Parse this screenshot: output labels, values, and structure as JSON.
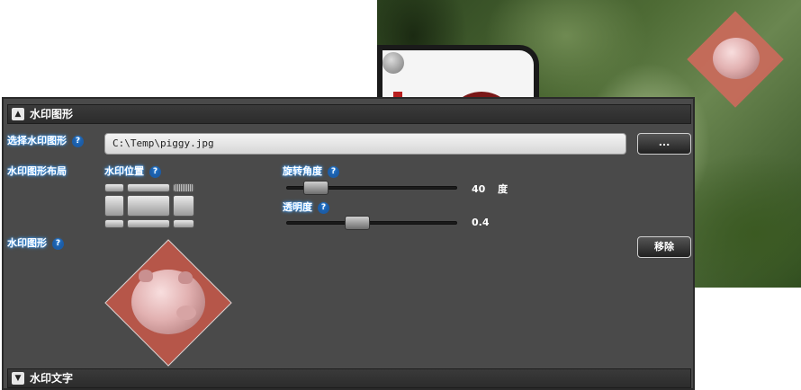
{
  "sections": {
    "graphic_title": "水印图形",
    "text_title": "水印文字"
  },
  "fields": {
    "select_label": "选择水印图形",
    "file_path": "C:\\Temp\\piggy.jpg",
    "browse_label": "...",
    "layout_label": "水印图形布局",
    "position_label": "水印位置",
    "rotation_label": "旋转角度",
    "rotation_value": "40",
    "rotation_unit": "度",
    "rotation_fraction": 0.12,
    "opacity_label": "透明度",
    "opacity_value": "0.4",
    "opacity_fraction": 0.4,
    "graphic_label": "水印图形",
    "remove_label": "移除",
    "help_glyph": "?"
  },
  "icons": {
    "collapse": "chevron-up-icon",
    "expand": "chevron-down-icon",
    "help": "help-icon"
  },
  "colors": {
    "panel_bg": "#4a4a4a",
    "label_glow": "#3fa0ff",
    "help_bg": "#1c5da8",
    "watermark_bg": "#b65649"
  }
}
